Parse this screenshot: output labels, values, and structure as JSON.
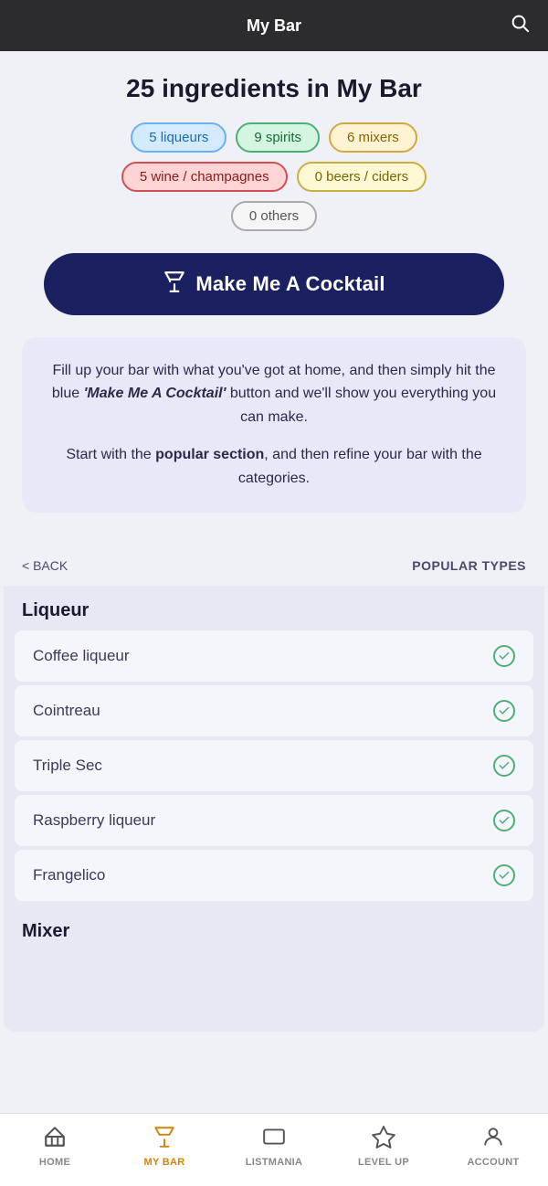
{
  "header": {
    "title": "My Bar",
    "search_icon": "search"
  },
  "summary": {
    "title": "25 ingredients in My Bar"
  },
  "tags": [
    {
      "id": "liqueurs",
      "label": "5 liqueurs",
      "class": "tag-liqueurs"
    },
    {
      "id": "spirits",
      "label": "9 spirits",
      "class": "tag-spirits"
    },
    {
      "id": "mixers",
      "label": "6 mixers",
      "class": "tag-mixers"
    },
    {
      "id": "wine",
      "label": "5 wine / champagnes",
      "class": "tag-wine"
    },
    {
      "id": "beers",
      "label": "0 beers / ciders",
      "class": "tag-beers"
    },
    {
      "id": "others",
      "label": "0 others",
      "class": "tag-others"
    }
  ],
  "cta": {
    "label": "Make Me A Cocktail"
  },
  "info_box": {
    "line1": "Fill up your bar with what you've got at home, and then simply hit the blue ",
    "line1_bold": "'Make Me A Cocktail'",
    "line1_end": " button and we'll show you everything you can make.",
    "line2_pre": "Start with the ",
    "line2_bold": "popular section",
    "line2_end": ", and then refine your bar with the categories."
  },
  "list": {
    "back_label": "< BACK",
    "popular_label": "POPULAR TYPES",
    "category1": "Liqueur",
    "items1": [
      {
        "name": "Coffee liqueur",
        "checked": true
      },
      {
        "name": "Cointreau",
        "checked": true
      },
      {
        "name": "Triple Sec",
        "checked": true
      },
      {
        "name": "Raspberry liqueur",
        "checked": true
      },
      {
        "name": "Frangelico",
        "checked": true
      }
    ],
    "category2": "Mixer"
  },
  "bottom_nav": [
    {
      "id": "home",
      "label": "HOME",
      "icon": "⌂",
      "active": false
    },
    {
      "id": "mybar",
      "label": "MY BAR",
      "icon": "🍸",
      "active": true
    },
    {
      "id": "listmania",
      "label": "LISTMANIA",
      "icon": "▭",
      "active": false
    },
    {
      "id": "levelup",
      "label": "LEVEL UP",
      "icon": "◈",
      "active": false
    },
    {
      "id": "account",
      "label": "ACCOUNT",
      "icon": "◯",
      "active": false
    }
  ]
}
